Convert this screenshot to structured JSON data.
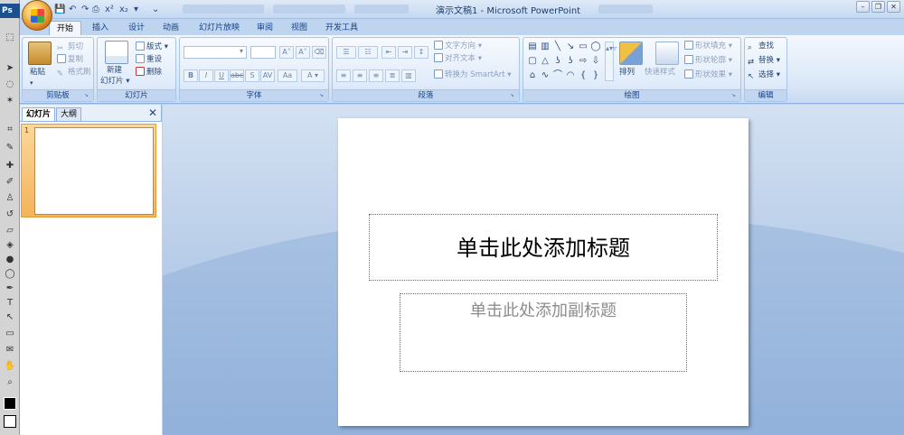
{
  "ps": {
    "logo": "Ps"
  },
  "window": {
    "title": "演示文稿1 - Microsoft PowerPoint"
  },
  "tabs": [
    "开始",
    "插入",
    "设计",
    "动画",
    "幻灯片放映",
    "审阅",
    "视图",
    "开发工具"
  ],
  "active_tab_index": 0,
  "ribbon": {
    "clipboard": {
      "label": "剪贴板",
      "paste": "粘贴",
      "cut": "剪切",
      "copy": "复制",
      "format_painter": "格式刷"
    },
    "slides": {
      "label": "幻灯片",
      "new_slide": "新建",
      "new_slide_2": "幻灯片 ▾",
      "layout": "版式 ▾",
      "reset": "重设",
      "delete": "删除"
    },
    "font": {
      "label": "字体"
    },
    "paragraph": {
      "label": "段落",
      "text_direction": "文字方向 ▾",
      "align_text": "对齐文本 ▾",
      "convert_smartart": "转换为 SmartArt ▾"
    },
    "drawing": {
      "label": "绘图",
      "arrange": "排列",
      "quick_styles": "快速样式",
      "shape_fill": "形状填充 ▾",
      "shape_outline": "形状轮廓 ▾",
      "shape_effects": "形状效果 ▾"
    },
    "editing": {
      "label": "编辑",
      "find": "查找",
      "replace": "替换 ▾",
      "select": "选择 ▾"
    }
  },
  "panel": {
    "tab_slides": "幻灯片",
    "tab_outline": "大纲",
    "slide_number": "1"
  },
  "slide": {
    "title_placeholder": "单击此处添加标题",
    "subtitle_placeholder": "单击此处添加副标题"
  }
}
